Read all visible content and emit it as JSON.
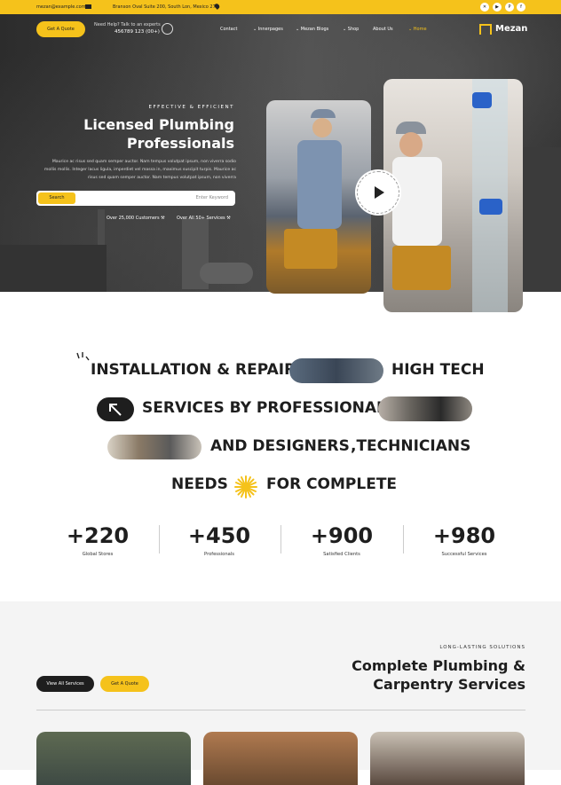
{
  "topbar": {
    "email": "mezan@example.com",
    "address": "Branson Oval Suite 200, South Lon, Mexico 276",
    "social_icons": [
      "x-icon",
      "youtube-icon",
      "pinterest-icon",
      "facebook-icon"
    ]
  },
  "header": {
    "quote_button": "Get A Quote",
    "help_text": "Need Help? Talk to an experts",
    "phone": "456789 123 (00+)",
    "menu": [
      "Contact",
      "Innerpages",
      "Mezan Blogs",
      "Shop",
      "About Us",
      "Home"
    ],
    "logo": "Mezan"
  },
  "hero": {
    "eyebrow": "EFFECTIVE & EFFICIENT",
    "title_line1": "Licensed Plumbing",
    "title_line2": "Professionals",
    "description": "Maurice ac risus sed quam semper auctor. Nam tempus volutpat ipsum, non viverra sodio mollis mollis. Integer lacus ligula, imperdiet vel massa in, maximus suscipit turpis. Maurice ac risus sed quam semper auctor. Nam tempus volutpat ipsum, non viverra",
    "search_button": "Search",
    "search_placeholder": "Enter Keyword",
    "customers": "Over 25,000 Customers",
    "services": "Over All 50+ Services",
    "play_ring_text": "Our Process • Our Process • Our Process •"
  },
  "services_marquee": {
    "row1_a": "INSTALLATION & REPAIR",
    "row1_b": "HIGH TECH",
    "row2": "SERVICES BY PROFESSIONAL",
    "row3_a": "AND DESIGNERS",
    "row3_b": ",TECHNICIANS",
    "row4_a": "NEEDS",
    "row4_b": "FOR COMPLETE"
  },
  "stats": [
    {
      "value": "+220",
      "label": "Global Stores"
    },
    {
      "value": "+450",
      "label": "Professionals"
    },
    {
      "value": "+900",
      "label": "Satisfied Clients"
    },
    {
      "value": "+980",
      "label": "Successful Services"
    }
  ],
  "solutions": {
    "eyebrow": "LONG-LASTING SOLUTIONS",
    "title_line1": "Complete Plumbing &",
    "title_line2": "Carpentry Services",
    "view_all": "View All Services",
    "get_quote": "Get A Quote"
  },
  "colors": {
    "accent": "#f5c21b",
    "dark": "#1e1e1e"
  }
}
